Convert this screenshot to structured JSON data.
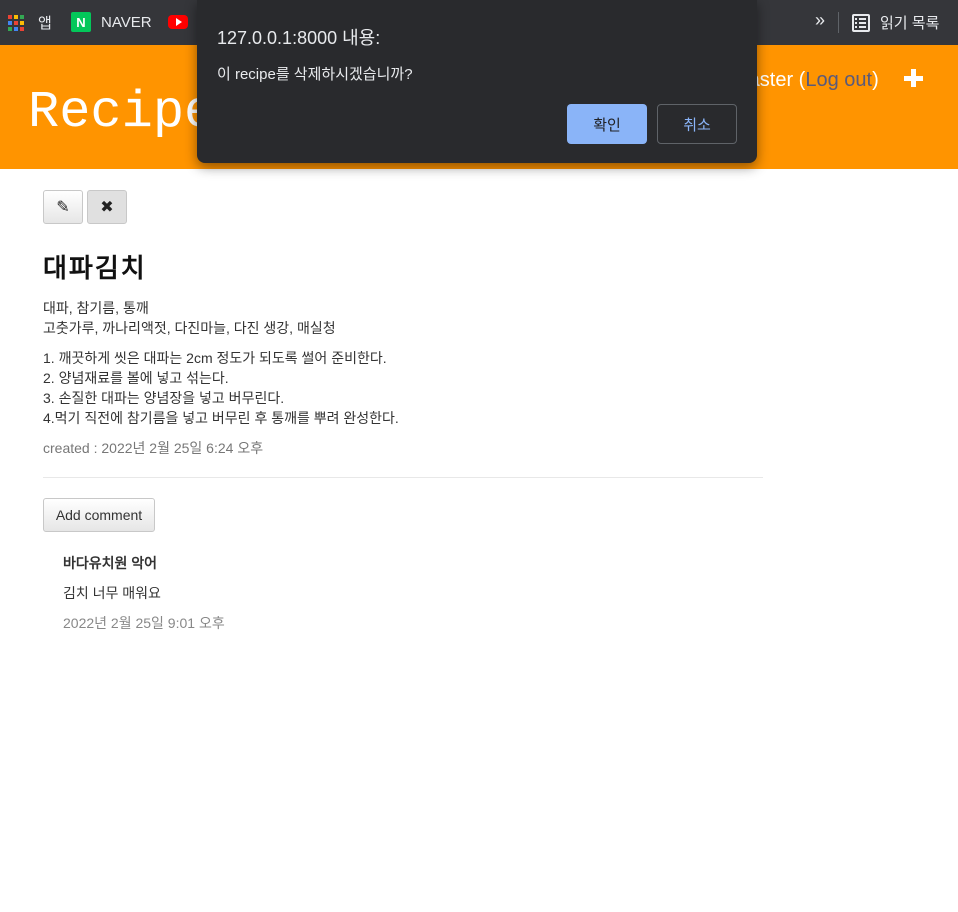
{
  "browser": {
    "bookmarks": [
      {
        "label": "앱",
        "icon": "apps-grid-icon"
      },
      {
        "label": "NAVER",
        "icon": "naver-icon",
        "badge": "N"
      },
      {
        "label": "",
        "icon": "youtube-icon"
      }
    ],
    "more_label": "»",
    "reading_list_label": "읽기 목록"
  },
  "header": {
    "site_title": "Recipe",
    "user_name": "master",
    "open_paren": " (",
    "logout_label": "Log out",
    "close_paren": ")",
    "accent_color": "#ff9400"
  },
  "toolbar": {
    "edit_icon_glyph": "✎",
    "delete_icon_glyph": "✖"
  },
  "recipe": {
    "title": "대파김치",
    "ingredients": [
      "대파, 참기름, 통깨",
      "고춧가루, 까나리액젓, 다진마늘, 다진 생강, 매실청"
    ],
    "steps": [
      "1. 깨끗하게 씻은 대파는 2cm 정도가 되도록 썰어 준비한다.",
      "2. 양념재료를 볼에 넣고 섞는다.",
      "3. 손질한 대파는 양념장을 넣고 버무린다.",
      "4.먹기 직전에 참기름을 넣고 버무린 후 통깨를 뿌려 완성한다."
    ],
    "created": "created : 2022년 2월 25일 6:24 오후"
  },
  "comments": {
    "add_label": "Add comment",
    "items": [
      {
        "author": "바다유치원 악어",
        "text": "김치 너무 매워요",
        "date": "2022년 2월 25일 9:01 오후"
      }
    ]
  },
  "dialog": {
    "title": "127.0.0.1:8000 내용:",
    "message": "이 recipe를 삭제하시겠습니까?",
    "ok_label": "확인",
    "cancel_label": "취소"
  }
}
